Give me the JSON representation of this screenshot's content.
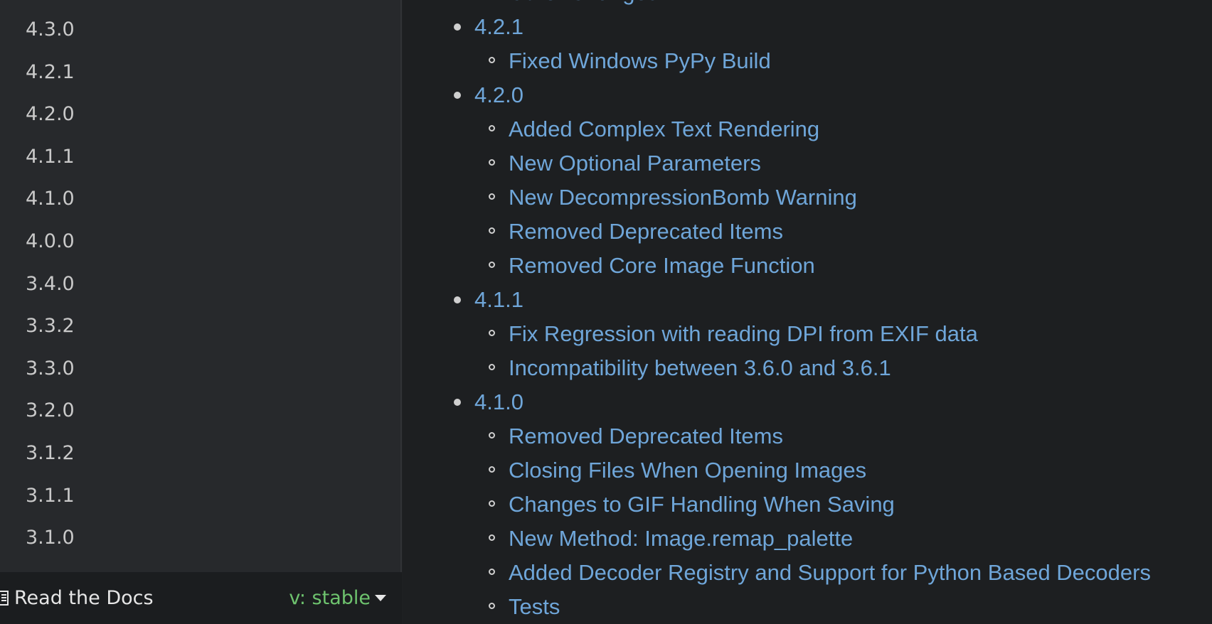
{
  "sidebar": {
    "versions": [
      "4.3.0",
      "4.2.1",
      "4.2.0",
      "4.1.1",
      "4.1.0",
      "4.0.0",
      "3.4.0",
      "3.3.2",
      "3.3.0",
      "3.2.0",
      "3.1.2",
      "3.1.1",
      "3.1.0"
    ]
  },
  "rtd_bar": {
    "label": "Read the Docs",
    "version": "v: stable",
    "book_icon": "book-icon",
    "caret_icon": "caret-down-icon"
  },
  "toc": [
    {
      "level": 2,
      "text": "Other Changes"
    },
    {
      "level": 1,
      "text": "4.2.1"
    },
    {
      "level": 2,
      "text": "Fixed Windows PyPy Build"
    },
    {
      "level": 1,
      "text": "4.2.0"
    },
    {
      "level": 2,
      "text": "Added Complex Text Rendering"
    },
    {
      "level": 2,
      "text": "New Optional Parameters"
    },
    {
      "level": 2,
      "text": "New DecompressionBomb Warning"
    },
    {
      "level": 2,
      "text": "Removed Deprecated Items"
    },
    {
      "level": 2,
      "text": "Removed Core Image Function"
    },
    {
      "level": 1,
      "text": "4.1.1"
    },
    {
      "level": 2,
      "text": "Fix Regression with reading DPI from EXIF data"
    },
    {
      "level": 2,
      "text": "Incompatibility between 3.6.0 and 3.6.1"
    },
    {
      "level": 1,
      "text": "4.1.0"
    },
    {
      "level": 2,
      "text": "Removed Deprecated Items"
    },
    {
      "level": 2,
      "text": "Closing Files When Opening Images"
    },
    {
      "level": 2,
      "text": "Changes to GIF Handling When Saving"
    },
    {
      "level": 2,
      "text": "New Method: Image.remap_palette"
    },
    {
      "level": 2,
      "text": "Added Decoder Registry and Support for Python Based Decoders"
    },
    {
      "level": 2,
      "text": "Tests"
    }
  ],
  "colors": {
    "link": "#6fa6d9",
    "sidebar_bg": "#27292c",
    "main_bg": "#1d1f21",
    "version_green": "#6ec36e"
  }
}
